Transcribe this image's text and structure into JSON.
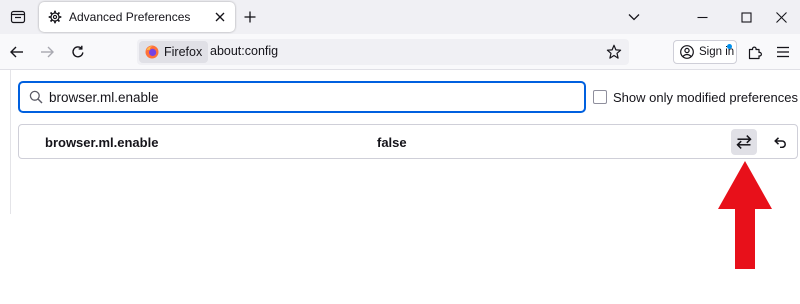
{
  "tab": {
    "title": "Advanced Preferences",
    "icon": "gear-icon"
  },
  "navbar": {
    "identity_label": "Firefox",
    "url": "about:config",
    "signin_label": "Sign in"
  },
  "config": {
    "search_value": "browser.ml.enable",
    "show_modified_label": "Show only modified preferences",
    "show_modified_checked": false,
    "preference": {
      "name": "browser.ml.enable",
      "value": "false"
    }
  },
  "colors": {
    "accent": "#0060df",
    "tabstrip_bg": "#f0f0f4",
    "annotation_arrow": "#e8101a",
    "notification_dot": "#0090ed"
  }
}
